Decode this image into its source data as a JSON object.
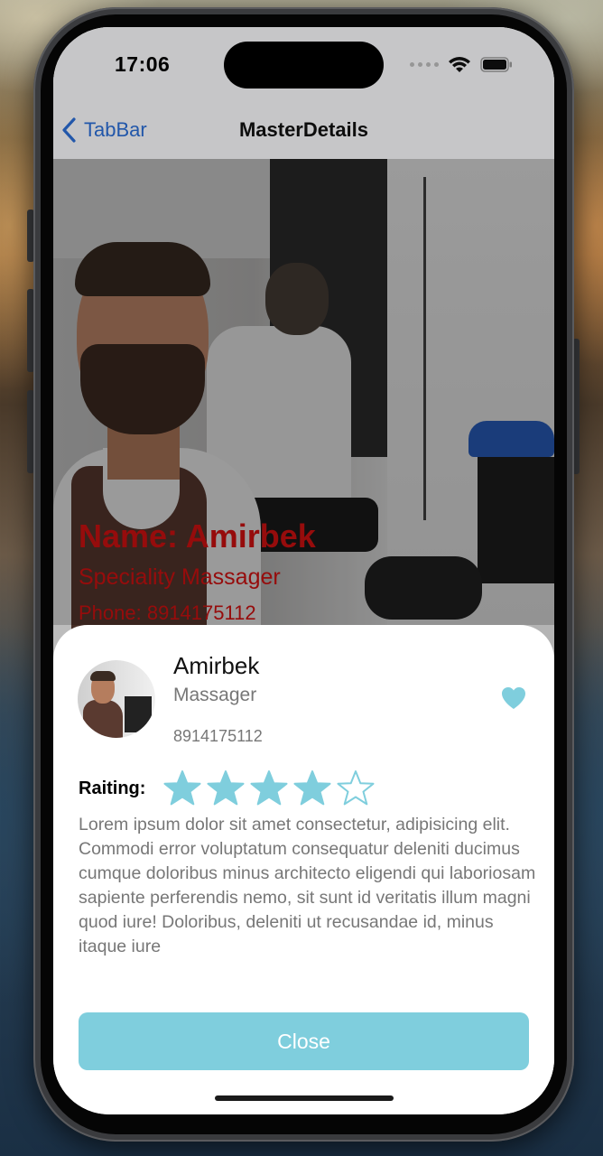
{
  "status_bar": {
    "time": "17:06",
    "icons": [
      "cellular-icon",
      "wifi-icon",
      "battery-icon"
    ]
  },
  "nav": {
    "back_label": "TabBar",
    "title": "MasterDetails"
  },
  "hero": {
    "name_line": "Name: Amirbek",
    "speciality_line": "Speciality Massager",
    "phone_line": "Phone: 8914175112"
  },
  "sheet": {
    "name": "Amirbek",
    "speciality": "Massager",
    "phone": "8914175112",
    "favorite_icon": "heart-icon",
    "rating_label": "Raiting:",
    "rating": 4,
    "rating_max": 5,
    "description": "Lorem ipsum dolor sit amet consectetur, adipisicing elit. Commodi error voluptatum consequatur deleniti ducimus cumque doloribus minus architecto eligendi qui laboriosam sapiente perferendis nemo, sit sunt id veritatis illum magni quod iure! Doloribus, deleniti ut recusandae id, minus itaque iure",
    "close_label": "Close"
  },
  "colors": {
    "accent": "#7fcedd",
    "nav_link": "#2a6bd0",
    "hero_text": "#b80f0f",
    "secondary_text": "#777777"
  }
}
